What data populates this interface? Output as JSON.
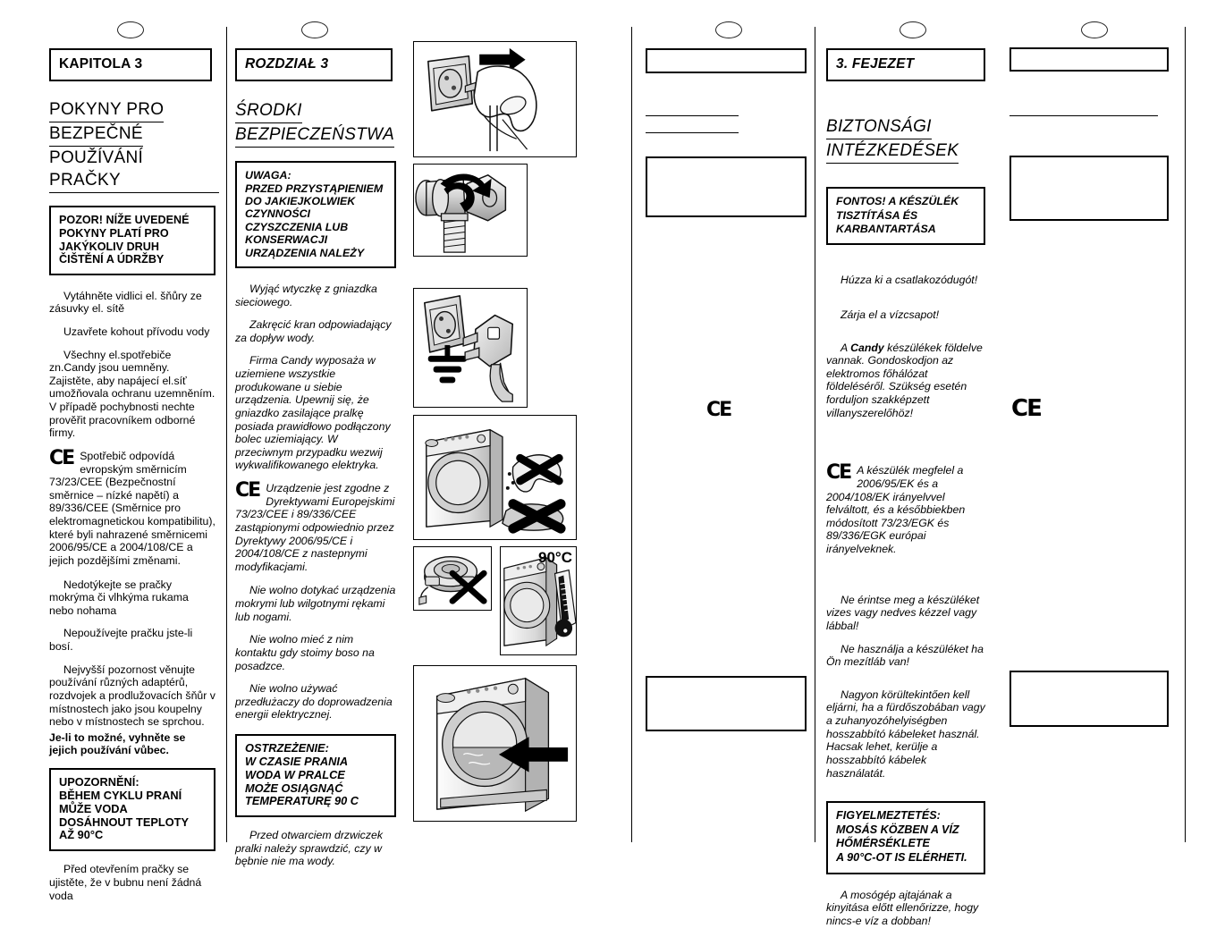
{
  "document": {
    "kind": "appliance-manual-spread",
    "language_columns": [
      "CZ",
      "PL",
      "illustrations",
      "blank",
      "HU",
      "blank"
    ]
  },
  "markers": {
    "oval_icon": "oval-page-marker"
  },
  "cz": {
    "chapter": "KAPITOLA 3",
    "title_lines": [
      "POKYNY PRO",
      "BEZPEČNÉ",
      "POUŽÍVÁNÍ PRAČKY"
    ],
    "notice_lines": [
      "POZOR! NÍŽE UVEDENÉ",
      "POKYNY PLATÍ PRO",
      "JAKÝKOLIV DRUH",
      "ČIŠTĚNÍ A ÚDRŽBY"
    ],
    "paragraphs": [
      "Vytáhněte vidlici el. šňůry ze zásuvky el. sítě",
      "Uzavřete kohout přívodu vody",
      "Všechny el.spotřebiče zn.Candy jsou uemněny. Zajistěte, aby napájecí el.síť umožňovala ochranu uzemněním.\nV případě pochybnosti nechte prověřit pracovníkem odborné firmy."
    ],
    "ce_paragraph": "Spotřebič odpovídá evropským směrnicím 73/23/CEE (Bezpečnostní směrnice – nízké napětí) a 89/336/CEE (Směrnice pro elektromagnetickou kompatibilitu), které byli nahrazené směrnicemi 2006/95/CE a 2004/108/CE a jejich pozdějšími změnami.",
    "paragraphs2": [
      "Nedotýkejte se pračky mokrýma či vlhkýma rukama nebo nohama",
      "Nepoužívejte pračku jste-li bosí."
    ],
    "adapter_paragraph": "Nejvyšší pozornost věnujte používání různých adaptérů, rozdvojek a prodlužovacích šňůr v místnostech jako jsou koupelny nebo v místnostech se sprchou.",
    "adapter_bold": "Je-li to možné, vyhněte se jejich používání vůbec.",
    "warning_lines": [
      "UPOZORNĚNÍ:",
      "BĚHEM CYKLU PRANÍ",
      "MŮŽE VODA",
      "DOSÁHNOUT TEPLOTY",
      "AŽ 90°C"
    ],
    "last_paragraph": "Před otevřením pračky se ujistěte, že v bubnu není žádná voda"
  },
  "pl": {
    "chapter": "ROZDZIAŁ 3",
    "title_lines": [
      "ŚRODKI",
      "BEZPIECZEŃSTWA"
    ],
    "notice_lines": [
      "UWAGA:",
      "PRZED PRZYSTĄPIENIEM",
      "DO JAKIEJKOLWIEK",
      "CZYNNOŚCI",
      "CZYSZCZENIA LUB",
      "KONSERWACJI",
      "URZĄDZENIA NALEŻY"
    ],
    "paragraphs": [
      "Wyjąć  wtyczkę z gniazdka sieciowego.",
      "Zakręcić kran odpowiadający za dopływ wody.",
      "Firma Candy wyposaża w uziemiene wszystkie produkowane u siebie urządzenia. Upewnij się, że gniazdko zasilające pralkę posiada prawidłowo podłączony bolec uziemiający. W przeciwnym przypadku wezwij wykwalifikowanego elektryka."
    ],
    "ce_paragraph": "Urządzenie jest zgodne z Dyrektywami Europejskimi 73/23/CEE  i  89/336/CEE zastąpionymi odpowiednio przez  Dyrektywy 2006/95/CE i 2004/108/CE z nastepnymi modyfikacjami.",
    "paragraphs2": [
      "Nie wolno dotykać urządzenia mokrymi lub wilgotnymi rękami lub nogami.",
      "Nie wolno mieć z nim kontaktu gdy stoimy boso na posadzce.",
      "Nie wolno używać przedłużaczy do doprowadzenia energii elektrycznej."
    ],
    "warning_lines": [
      "OSTRZEŻENIE:",
      "W CZASIE PRANIA",
      "WODA W PRALCE",
      "MOŻE OSIĄGNĄĆ",
      "TEMPERATURĘ 90 C"
    ],
    "last_paragraph": "Przed otwarciem drzwiczek pralki należy sprawdzić, czy w bębnie nie ma wody."
  },
  "hu": {
    "chapter": "3. FEJEZET",
    "title_lines": [
      "BIZTONSÁGI",
      "INTÉZKEDÉSEK"
    ],
    "notice_lines": [
      "FONTOS! A KÉSZÜLÉK",
      "TISZTÍTÁSA ÉS",
      "KARBANTARTÁSA"
    ],
    "paragraphs": [
      "Húzza ki a csatlakozódugót!",
      "Zárja el a vízcsapot!"
    ],
    "candy_paragraph_pre": "A ",
    "candy_bold": "Candy",
    "candy_paragraph_post": " készülékek földelve vannak. Gondoskodjon az elektromos főhálózat földeléséről. Szükség esetén forduljon szakképzett villanyszerelőhöz!",
    "ce_paragraph": "A készülék megfelel a 2006/95/EK és a 2004/108/EK irányelvvel felváltott, és a későbbiekben módosított 73/23/EGK és 89/336/EGK európai irányelveknek.",
    "paragraphs2": [
      "Ne érintse meg a készüléket vizes vagy nedves kézzel vagy lábbal!",
      "Ne használja a készüléket ha Ön mezítláb van!",
      "Nagyon körültekintően kell eljárni, ha a fürdőszobában vagy a zuhanyozóhelyiségben hosszabbító kábeleket használ. Hacsak lehet, kerülje a hosszabbító kábelek használatát."
    ],
    "warning_lines": [
      "FIGYELMEZTETÉS:",
      "MOSÁS KÖZBEN A VÍZ",
      "HŐMÉRSÉKLETE",
      "A 90°C-OT IS ELÉRHETI."
    ],
    "last_paragraph": "A mosógép ajtajának a kinyitása előtt ellenőrizze, hogy nincs-e víz a dobban!"
  },
  "blank_col_a": {
    "ce_mark": "CE"
  },
  "blank_col_b": {
    "ce_mark": "CE"
  },
  "illustrations": {
    "panel1": {
      "name": "unplug-socket-illustration",
      "caption": ""
    },
    "panel2": {
      "name": "close-water-tap-illustration",
      "caption": ""
    },
    "panel3": {
      "name": "earthed-socket-plug-illustration",
      "caption": ""
    },
    "panel4": {
      "name": "no-wet-hands-feet-illustration",
      "caption": ""
    },
    "panel5": {
      "name": "no-extension-cord-illustration",
      "caption": ""
    },
    "panel6": {
      "name": "water-temperature-illustration",
      "caption": "90°C"
    },
    "panel7": {
      "name": "check-drum-empty-illustration",
      "caption": ""
    }
  }
}
